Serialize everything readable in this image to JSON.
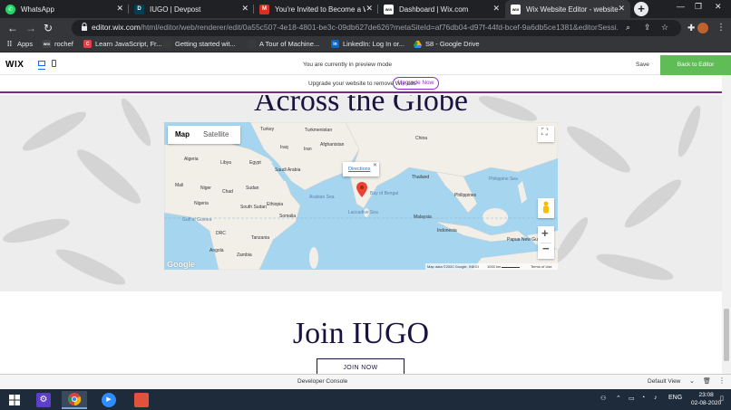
{
  "browser": {
    "tabs": [
      {
        "title": "WhatsApp",
        "icon": "whatsapp-icon",
        "color": "#25d366",
        "glyph": "●"
      },
      {
        "title": "IUGO | Devpost",
        "icon": "devpost-icon",
        "color": "#003e54",
        "glyph": "D"
      },
      {
        "title": "You're Invited to Become a Wel",
        "icon": "gmail-icon",
        "color": "#d93025",
        "glyph": "M"
      },
      {
        "title": "Dashboard | Wix.com",
        "icon": "wix-icon",
        "color": "#000000",
        "glyph": "WIX"
      },
      {
        "title": "Wix Website Editor - website",
        "icon": "wix-icon",
        "color": "#000000",
        "glyph": "WIX"
      }
    ],
    "address": {
      "domain": "editor.wix.com",
      "path": "/html/editor/web/renderer/edit/0a55c507-4e18-4801-be3c-09db627de626?metaSiteId=af76db04-d97f-44fd-bcef-9a6db5ce1381&editorSessi..."
    },
    "bookmarks": [
      {
        "label": "Apps",
        "icon": "apps-icon",
        "color": "#5f6368"
      },
      {
        "label": "rochef",
        "icon": "wix-icon",
        "color": "#444444"
      },
      {
        "label": "Learn JavaScript, Fr...",
        "icon": "codecademy-icon",
        "color": "#e0424b"
      },
      {
        "label": "Getting started wit...",
        "icon": "page-icon",
        "color": "#3a3a3a"
      },
      {
        "label": "A Tour of Machine...",
        "icon": "page-icon",
        "color": "#3a3a3a"
      },
      {
        "label": "LinkedIn: Log In or...",
        "icon": "linkedin-icon",
        "color": "#0a66c2"
      },
      {
        "label": "S8 - Google Drive",
        "icon": "drive-icon",
        "color": "#f4b400"
      }
    ]
  },
  "wix": {
    "logo": "WIX",
    "preview_text": "You are currently in preview mode",
    "save_label": "Save",
    "back_label": "Back to Editor",
    "ads_text": "Upgrade your website to remove Wix ads",
    "upgrade_label": "Upgrade Now"
  },
  "page": {
    "section1_title": "Across the Globe",
    "section2_title": "Join IUGO",
    "join_label": "JOIN NOW"
  },
  "map": {
    "tab_map": "Map",
    "tab_satellite": "Satellite",
    "popup_label": "Directions",
    "google_label": "Google",
    "attribution": "Map data ©2020 Google, INEGI",
    "scale_label": "1000 km",
    "terms_label": "Terms of Use",
    "labels": {
      "turkey": "Turkey",
      "turkmenistan": "Turkmenistan",
      "china": "China",
      "afghanistan": "Afghanistan",
      "iraq": "Iraq",
      "iran": "Iran",
      "algeria": "Algeria",
      "libya": "Libya",
      "egypt": "Egypt",
      "saudi": "Saudi Arabia",
      "mali": "Mali",
      "niger": "Niger",
      "chad": "Chad",
      "sudan": "Sudan",
      "nigeria": "Nigeria",
      "ethiopia": "Ethiopia",
      "somalia": "Somalia",
      "south_sudan": "South Sudan",
      "arabian_sea": "Arabian Sea",
      "bay_bengal": "Bay of Bengal",
      "thailand": "Thailand",
      "philippines": "Philippines",
      "philippine_sea": "Philippine Sea",
      "malaysia": "Malaysia",
      "indonesia": "Indonesia",
      "drc": "DRC",
      "tanzania": "Tanzania",
      "angola": "Angola",
      "zambia": "Zambia",
      "png": "Papua New Guinea",
      "gulf_guinea": "Gulf of Guinea",
      "laccadive": "Laccadive Sea",
      "india": "India"
    }
  },
  "console": {
    "label": "Developer Console",
    "view": "Default View"
  },
  "taskbar": {
    "lang": "ENG",
    "time": "23:08",
    "date": "02-08-2020"
  }
}
